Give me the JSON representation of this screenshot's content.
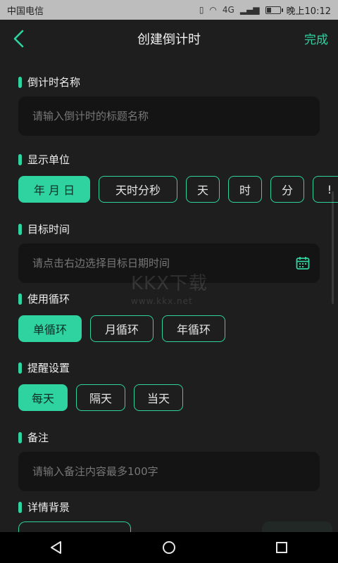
{
  "status": {
    "carrier": "中国电信",
    "network": "4G",
    "time": "晚上10:12"
  },
  "header": {
    "title": "创建倒计时",
    "done_label": "完成"
  },
  "sections": {
    "name": {
      "title": "倒计时名称",
      "placeholder": "请输入倒计时的标题名称"
    },
    "unit": {
      "title": "显示单位",
      "options": [
        "年 月 日",
        "天时分秒",
        "天",
        "时",
        "分",
        "!"
      ]
    },
    "target": {
      "title": "目标时间",
      "placeholder": "请点击右边选择目标日期时间"
    },
    "loop": {
      "title": "使用循环",
      "options": [
        "单循环",
        "月循环",
        "年循环"
      ]
    },
    "reminder": {
      "title": "提醒设置",
      "options": [
        "每天",
        "隔天",
        "当天"
      ]
    },
    "note": {
      "title": "备注",
      "placeholder": "请输入备注内容最多100字"
    },
    "background": {
      "title": "详情背景"
    }
  },
  "watermark": {
    "main": "KKX下载",
    "sub": "www.kkx.net"
  },
  "colors": {
    "accent": "#2ed3a0",
    "background": "#1e1e1e",
    "input": "#141414"
  }
}
